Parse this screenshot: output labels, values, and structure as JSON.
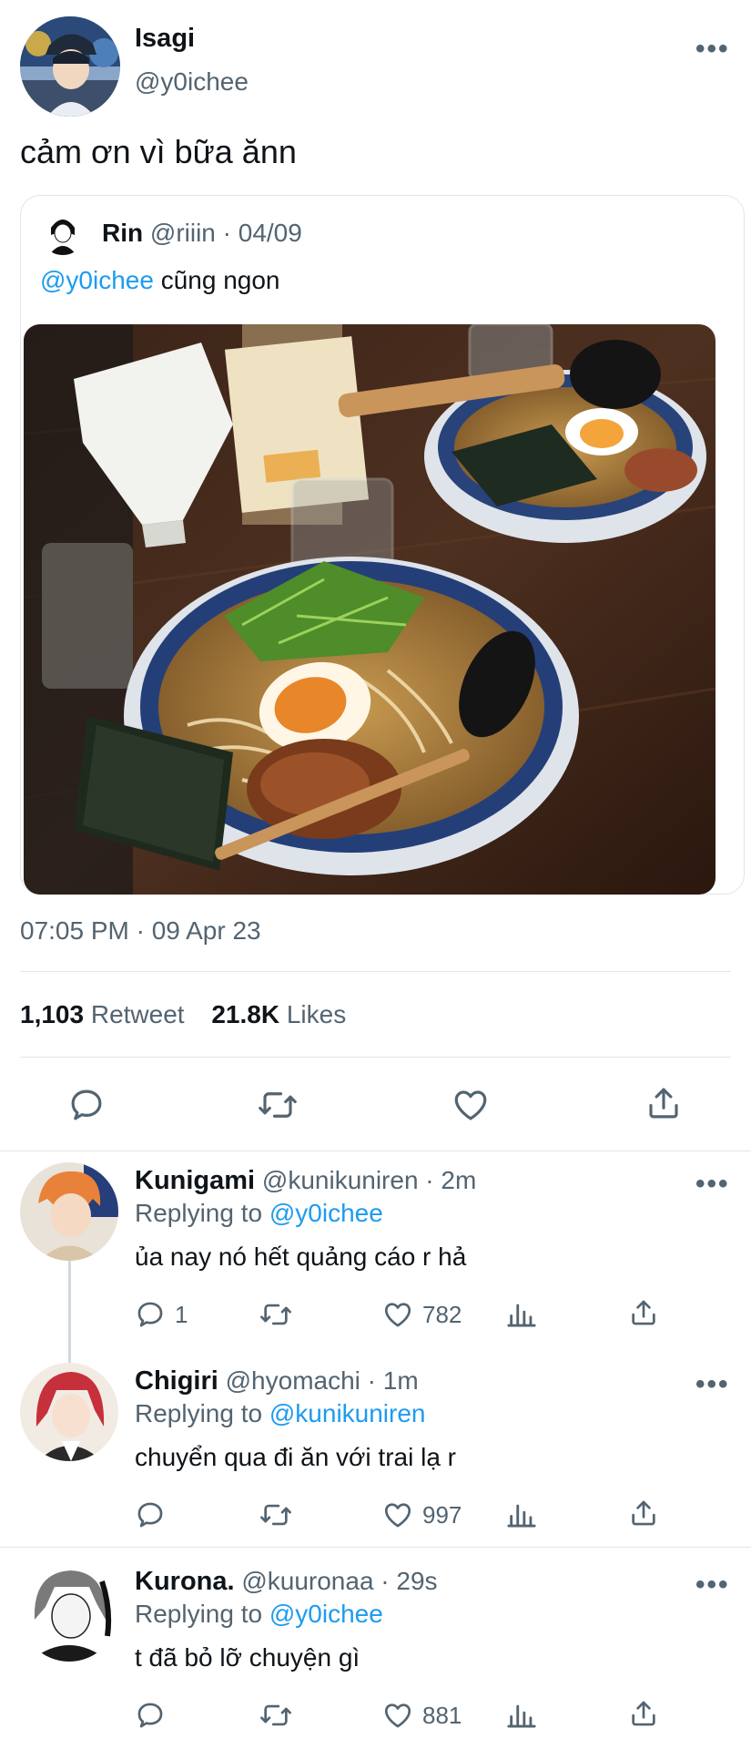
{
  "tweet": {
    "author_name": "Isagi",
    "author_handle": "@y0ichee",
    "text": "cảm ơn vì bữa ănn",
    "timestamp": "07:05 PM · 09 Apr 23",
    "retweets_count": "1,103",
    "retweets_label": "Retweet",
    "likes_count": "21.8K",
    "likes_label": "Likes",
    "menu": "•••"
  },
  "quote": {
    "author_name": "Rin",
    "meta": "@riiin · 04/09",
    "mention": "@y0ichee",
    "text": " cũng ngon"
  },
  "replies": [
    {
      "name": "Kunigami",
      "meta": "@kunikuniren · 2m",
      "replying_label": "Replying to ",
      "replying_to": "@y0ichee",
      "text": "ủa nay nó hết quảng cáo r hả",
      "reply_count": "1",
      "like_count": "782"
    },
    {
      "name": "Chigiri",
      "meta": "@hyomachi · 1m",
      "replying_label": "Replying to ",
      "replying_to": "@kunikuniren",
      "text": "chuyển qua đi ăn với trai lạ r",
      "reply_count": "",
      "like_count": "997"
    },
    {
      "name": "Kurona.",
      "meta": "@kuuronaa · 29s",
      "replying_label": "Replying to ",
      "replying_to": "@y0ichee",
      "text": "t đã bỏ lỡ chuyện gì",
      "reply_count": "",
      "like_count": "881"
    }
  ],
  "colors": {
    "accent": "#1d9bf0",
    "text": "#0f1419",
    "secondary": "#536471",
    "divider": "#e1e6ea"
  }
}
